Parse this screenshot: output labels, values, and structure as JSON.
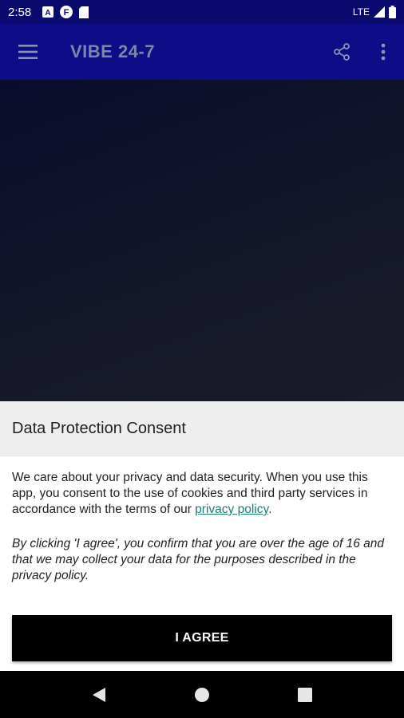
{
  "status_bar": {
    "time": "2:58",
    "network": "LTE",
    "icons_left": [
      "a-badge-icon",
      "f-badge-icon",
      "sd-card-icon"
    ]
  },
  "app_bar": {
    "title": "VIBE 24-7"
  },
  "dialog": {
    "title": "Data Protection Consent",
    "body_text": "We care about your privacy and data security. When you use this app, you consent to the use of cookies and third party services in accordance with the terms of our ",
    "policy_link": "privacy policy",
    "body_end": ".",
    "disclaimer": "By clicking 'I agree', you confirm that you are over the age of 16 and that we may collect your data for the purposes described in the privacy policy.",
    "agree_label": "I AGREE"
  },
  "colors": {
    "app_bar": "#0d0d87",
    "status_bar": "#0a0a6e",
    "link": "#1a7e76",
    "button": "#000000"
  }
}
